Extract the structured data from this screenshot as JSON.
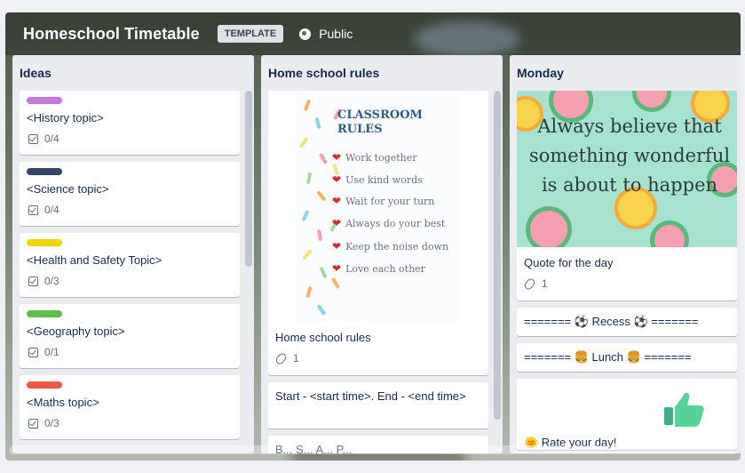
{
  "board": {
    "title": "Homeschool Timetable",
    "badge": "TEMPLATE",
    "visibility": "Public"
  },
  "lists": [
    {
      "title": "Ideas",
      "cards": [
        {
          "title": "<History topic>",
          "label_color": "#c377e0",
          "checklist": "0/4"
        },
        {
          "title": "<Science topic>",
          "label_color": "#344563",
          "checklist": "0/4"
        },
        {
          "title": "<Health and Safety Topic>",
          "label_color": "#f2d600",
          "checklist": "0/3"
        },
        {
          "title": "<Geography topic>",
          "label_color": "#61bd4f",
          "checklist": "0/1"
        },
        {
          "title": "<Maths topic>",
          "label_color": "#eb5a46",
          "checklist": "0/3"
        }
      ]
    },
    {
      "title": "Home school rules",
      "cover": {
        "heading": "CLASSROOM RULES",
        "rules": [
          "Work together",
          "Use kind words",
          "Wait for your turn",
          "Always do your best",
          "Keep the noise down",
          "Love each other"
        ]
      },
      "cards": [
        {
          "title": "Home school rules",
          "attachments": "1"
        },
        {
          "title": "Start - <start time>. End - <end time>"
        },
        {
          "title": "B... S... A... P..."
        }
      ]
    },
    {
      "title": "Monday",
      "cover": {
        "quote": "Always believe that something wonderful is about to happen"
      },
      "cards": [
        {
          "title": "Quote for the day",
          "attachments": "1"
        },
        {
          "title": "======= ⚽ Recess ⚽ ======="
        },
        {
          "title": "======= 🍔 Lunch 🍔 ======="
        },
        {
          "title": "🌞 Rate your day!"
        }
      ]
    }
  ],
  "colors": {
    "heart": "#d8292f",
    "rules_heading": "#2d5a8c",
    "quote_bg": "#a7e2d0"
  },
  "icons": [
    "globe-icon",
    "checklist-icon",
    "attachment-icon",
    "heart-icon",
    "soccer-ball-icon",
    "burger-icon",
    "sun-icon",
    "thumbs-up-icon"
  ]
}
